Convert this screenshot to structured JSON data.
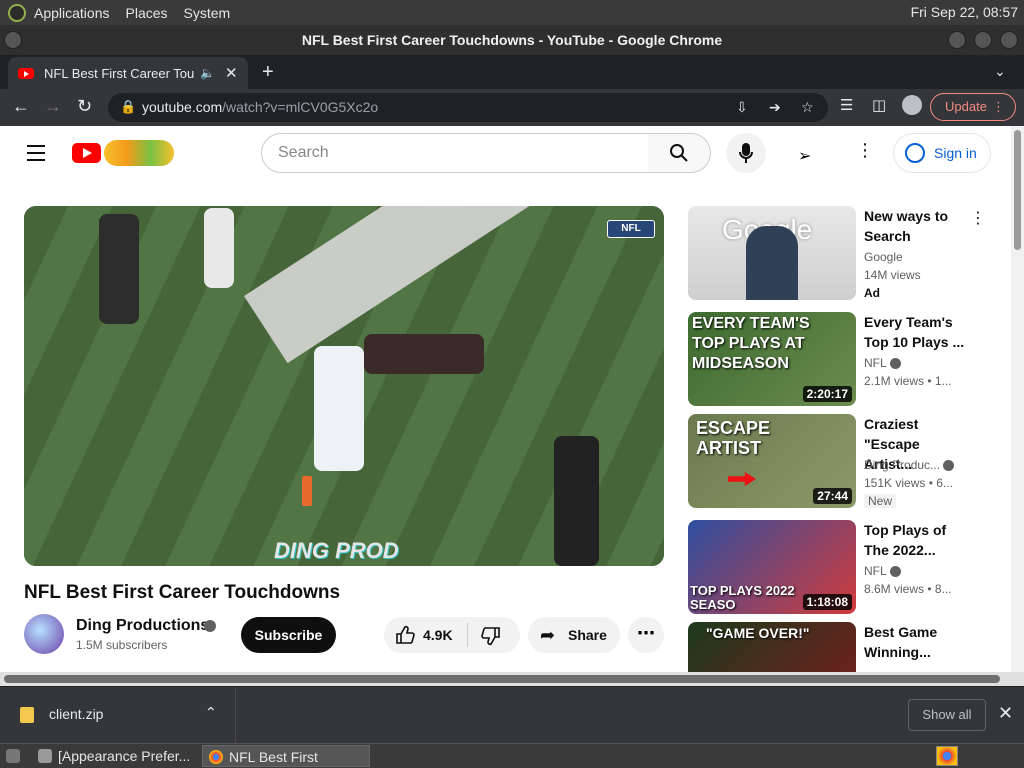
{
  "gnome_panel": {
    "menus": [
      "Applications",
      "Places",
      "System"
    ],
    "clock": "Fri Sep 22, 08:57"
  },
  "window": {
    "title": "NFL Best First Career Touchdowns - YouTube - Google Chrome"
  },
  "tab": {
    "label": "NFL Best First Career Tou"
  },
  "omnibox": {
    "host": "youtube.com",
    "path": "/watch?v=mlCV0G5Xc2o",
    "update_label": "Update"
  },
  "youtube": {
    "search_placeholder": "Search",
    "sign_in_label": "Sign in",
    "video": {
      "title": "NFL Best First Career Touchdowns",
      "watermark": "DING PROD",
      "network_badge": "NFL",
      "channel": "Ding Productions",
      "subscribers": "1.5M subscribers",
      "subscribe_label": "Subscribe",
      "likes": "4.9K",
      "share_label": "Share"
    },
    "recommendations": [
      {
        "title": "New ways to Search",
        "channel": "Google",
        "views": "14M views",
        "badge": "Ad",
        "thumb_text": "Google",
        "duration": ""
      },
      {
        "title": "Every Team's Top 10 Plays ...",
        "channel": "NFL",
        "views": "2.1M views",
        "extra": "• 1...",
        "thumb_text": "EVERY TEAM'S TOP PLAYS AT MIDSEASON",
        "duration": "2:20:17"
      },
      {
        "title": "Craziest \"Escape Artist...",
        "channel": "Ding Produc...",
        "views": "151K views",
        "extra": "• 6...",
        "badge": "New",
        "thumb_text": "ESCAPE ARTIST",
        "duration": "27:44"
      },
      {
        "title": "Top Plays of The 2022...",
        "channel": "NFL",
        "views": "8.6M views",
        "extra": "• 8...",
        "thumb_text": "TOP PLAYS 2022 SEASO",
        "duration": "1:18:08"
      },
      {
        "title": "Best Game Winning...",
        "thumb_text": "\"GAME OVER!\""
      }
    ]
  },
  "downloads": {
    "file": "client.zip",
    "show_all_label": "Show all"
  },
  "taskbar": {
    "tasks": [
      "[Appearance Prefer...",
      "NFL Best First Caree..."
    ]
  }
}
